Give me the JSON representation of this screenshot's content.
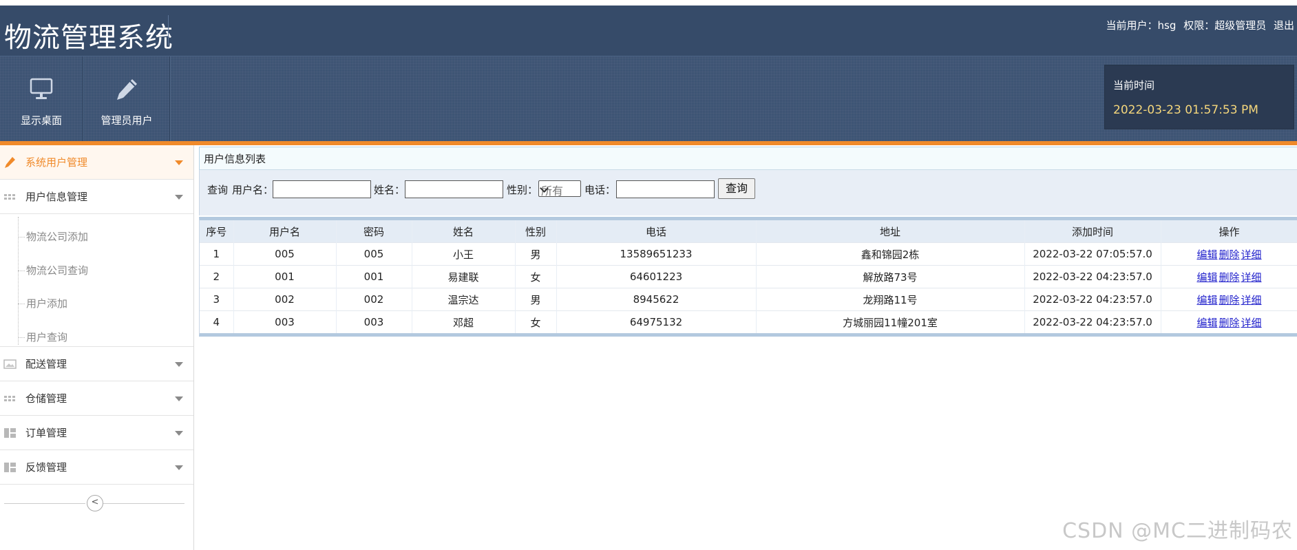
{
  "header": {
    "title": "物流管理系统",
    "user_label": "当前用户：hsg",
    "role_label": "权限：超级管理员",
    "logout": "退出",
    "nav": [
      {
        "label": "显示桌面",
        "icon": "monitor-icon"
      },
      {
        "label": "管理员用户",
        "icon": "pencil-icon"
      }
    ],
    "time_label": "当前时间",
    "time_value": "2022-03-23 01:57:53 PM"
  },
  "sidebar": {
    "menus": [
      {
        "label": "系统用户管理",
        "icon": "pencil-icon",
        "active": true
      },
      {
        "label": "用户信息管理",
        "icon": "grid-icon"
      },
      {
        "label": "配送管理",
        "icon": "image-icon"
      },
      {
        "label": "仓储管理",
        "icon": "grid-icon"
      },
      {
        "label": "订单管理",
        "icon": "layout-icon"
      },
      {
        "label": "反馈管理",
        "icon": "layout-icon"
      }
    ],
    "submenu": [
      "物流公司添加",
      "物流公司查询",
      "用户添加",
      "用户查询"
    ],
    "collapse_symbol": "<"
  },
  "main": {
    "panel_title": "用户信息列表",
    "search": {
      "query_label": "查询",
      "username_label": "用户名：",
      "name_label": "姓名：",
      "gender_label": "性别：",
      "gender_selected": "所有",
      "phone_label": "电话：",
      "button": "查询"
    },
    "table": {
      "columns": [
        "序号",
        "用户名",
        "密码",
        "姓名",
        "性别",
        "电话",
        "地址",
        "添加时间",
        "操作"
      ],
      "rows": [
        [
          "1",
          "005",
          "005",
          "小王",
          "男",
          "13589651233",
          "鑫和锦园2栋",
          "2022-03-22 07:05:57.0"
        ],
        [
          "2",
          "001",
          "001",
          "易建联",
          "女",
          "64601223",
          "解放路73号",
          "2022-03-22 04:23:57.0"
        ],
        [
          "3",
          "002",
          "002",
          "温宗达",
          "男",
          "8945622",
          "龙翔路11号",
          "2022-03-22 04:23:57.0"
        ],
        [
          "4",
          "003",
          "003",
          "邓超",
          "女",
          "64975132",
          "方城丽园11幢201室",
          "2022-03-22 04:23:57.0"
        ]
      ],
      "actions": [
        "编辑",
        "删除",
        "详细"
      ]
    }
  },
  "watermark": "CSDN @MC二进制码农",
  "colors": {
    "header_bg": "#3e5474",
    "accent": "#f08a2a",
    "time_text": "#f5d77c",
    "link": "#2222cc"
  }
}
